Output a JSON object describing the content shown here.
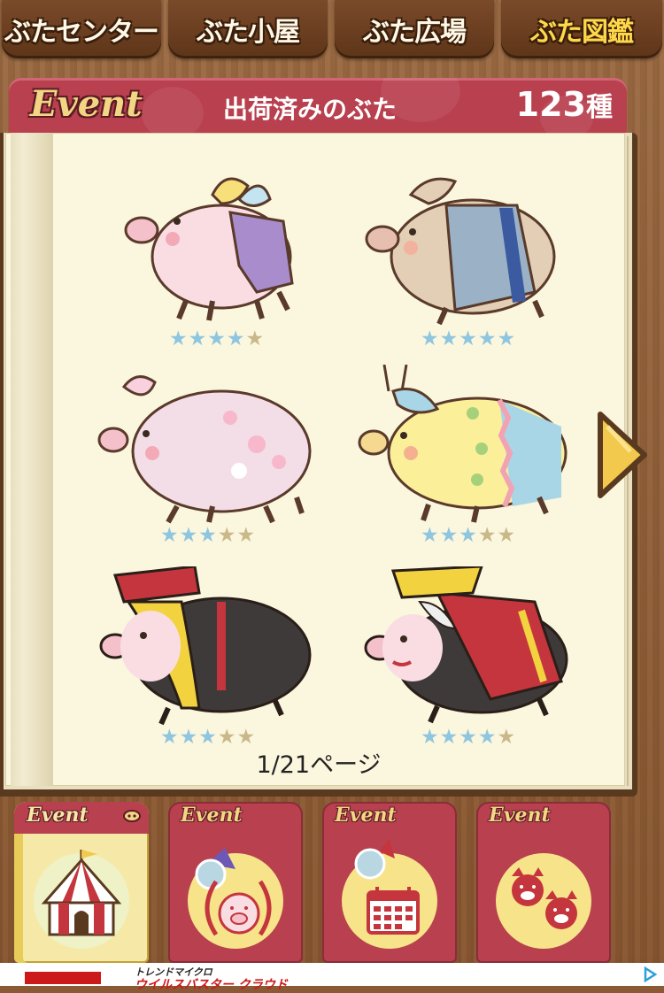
{
  "top_tabs": [
    {
      "label": "ぶたセンター",
      "active": false
    },
    {
      "label": "ぶた小屋",
      "active": false
    },
    {
      "label": "ぶた広場",
      "active": false
    },
    {
      "label": "ぶた図鑑",
      "active": true
    }
  ],
  "header": {
    "logo": "Event",
    "title": "出荷済みのぶた",
    "count": "123",
    "count_unit": "種"
  },
  "pigs": [
    {
      "name": "fairy-pig",
      "stars": 4,
      "max_stars": 5
    },
    {
      "name": "kimono-pig",
      "stars": 5,
      "max_stars": 5
    },
    {
      "name": "sakura-pig",
      "stars": 3,
      "max_stars": 5
    },
    {
      "name": "easter-egg-pig",
      "stars": 3,
      "max_stars": 5
    },
    {
      "name": "ainu-pig",
      "stars": 3,
      "max_stars": 5
    },
    {
      "name": "ainu-woman-pig",
      "stars": 4,
      "max_stars": 5
    }
  ],
  "page_indicator": "1/21ページ",
  "bottom_tabs": [
    {
      "label": "Event",
      "icon": "circus-tent-icon",
      "active": true
    },
    {
      "label": "Event",
      "icon": "pig-medal-icon",
      "active": false
    },
    {
      "label": "Event",
      "icon": "calendar-icon",
      "active": false
    },
    {
      "label": "Event",
      "icon": "pig-pair-icon",
      "active": false
    }
  ],
  "ad": {
    "brand": "トレンドマイクロ",
    "text": "ウイルスバスター クラウド"
  },
  "colors": {
    "header_red": "#b8404f",
    "star_on": "#8fc6df",
    "star_off": "#c9b98a",
    "active_tab_text": "#ffd84a"
  }
}
